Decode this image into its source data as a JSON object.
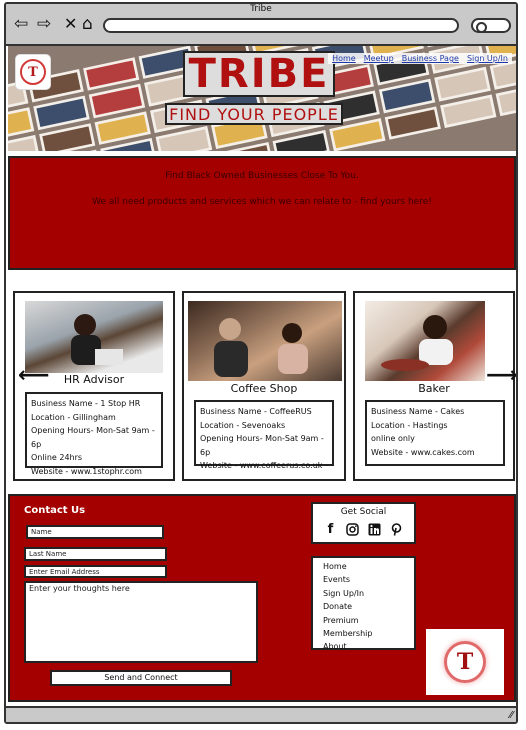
{
  "window": {
    "title": "Tribe"
  },
  "browser": {
    "back_icon": "back-arrow-icon",
    "forward_icon": "forward-arrow-icon",
    "close_icon": "close-icon",
    "home_icon": "home-icon",
    "search_icon": "search-icon"
  },
  "header": {
    "logo_text": "T",
    "brand": "TRIBE",
    "tagline": "FIND YOUR PEOPLE",
    "nav": [
      "Home",
      "Meetup",
      "Business Page",
      "Sign Up/In"
    ]
  },
  "banner": {
    "line1": "Find Black Owned Businesses Close To You.",
    "line2": "We all need products and services which we can relate to - find yours here!",
    "background": "#a40000"
  },
  "carousel": {
    "prev_icon": "arrow-left-icon",
    "next_icon": "arrow-right-icon",
    "cards": [
      {
        "category": "HR Advisor",
        "details": [
          "Business Name -  1 Stop HR",
          "Location - Gillingham",
          "Opening Hours- Mon-Sat 9am - 6p",
          "Online 24hrs",
          "Website - www.1stophr.com"
        ]
      },
      {
        "category": "Coffee Shop",
        "details": [
          "Business Name -  CoffeeRUS",
          "Location - Sevenoaks",
          "Opening Hours- Mon-Sat 9am - 6p",
          "Website - www.coffeerus.co.uk"
        ]
      },
      {
        "category": "Baker",
        "details": [
          "Business Name -  Cakes",
          "Location - Hastings",
          "online only",
          "Website - www.cakes.com"
        ]
      }
    ]
  },
  "footer": {
    "contact_title": "Contact Us",
    "fields": {
      "name_placeholder": "Name",
      "lastname_placeholder": "Last Name",
      "email_placeholder": "Enter Email Address",
      "message_placeholder": "Enter your thoughts here"
    },
    "send_label": "Send and Connect",
    "social": {
      "label": "Get Social",
      "icons": [
        "facebook-icon",
        "instagram-icon",
        "linkedin-icon",
        "pinterest-icon"
      ]
    },
    "menu": [
      "Home",
      "Events",
      "Sign Up/In",
      "Donate",
      "Premium Membership",
      "About"
    ],
    "logo_text": "T"
  }
}
